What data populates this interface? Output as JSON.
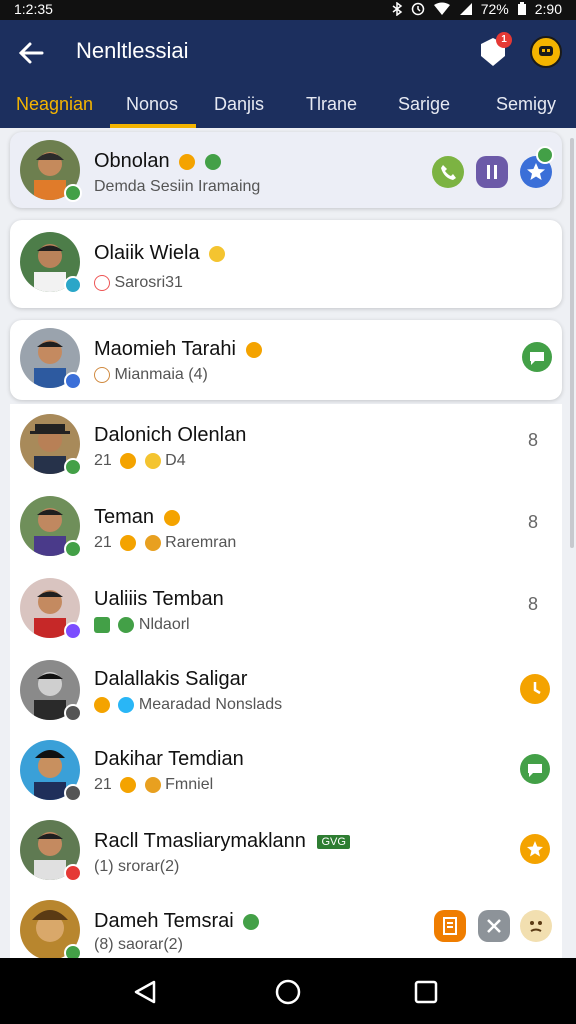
{
  "status": {
    "time": "1:2:35",
    "battery": "72%",
    "clock": "2:90"
  },
  "app": {
    "title": "Nenltlessiai",
    "notif_count": "1"
  },
  "tabs": [
    {
      "label": "Neagnian"
    },
    {
      "label": "Nonos"
    },
    {
      "label": "Danjis"
    },
    {
      "label": "Tlrane"
    },
    {
      "label": "Sarige"
    },
    {
      "label": "Semigy"
    }
  ],
  "contacts": [
    {
      "name": "Obnolan",
      "sub": "Demda Sesiin Iramaing"
    },
    {
      "name": "Olaiik Wiela",
      "sub": "Sarosri31"
    },
    {
      "name": "Maomieh Tarahi",
      "sub": "Mianmaia (4)"
    },
    {
      "name": "Dalonich Olenlan",
      "sub": "21",
      "sub2": "D4",
      "side": "8"
    },
    {
      "name": "Teman",
      "sub": "21",
      "sub2": "Raremran",
      "side": "8"
    },
    {
      "name": "Ualiiis Temban",
      "sub": "Nldaorl",
      "side": "8"
    },
    {
      "name": "Dalallakis Saligar",
      "sub": "Mearadad Nonslads"
    },
    {
      "name": "Dakihar Temdian",
      "sub": "21",
      "sub2": "Fmniel"
    },
    {
      "name": "Racll Tmasliarymaklann",
      "tag": "GVG",
      "sub": "(1) srorar(2)"
    },
    {
      "name": "Dameh Temsrai",
      "sub": "(8) saorar(2)"
    }
  ],
  "colors": {
    "appbar": "#1c2f5e",
    "accent": "#f4b400",
    "green": "#43a047"
  }
}
